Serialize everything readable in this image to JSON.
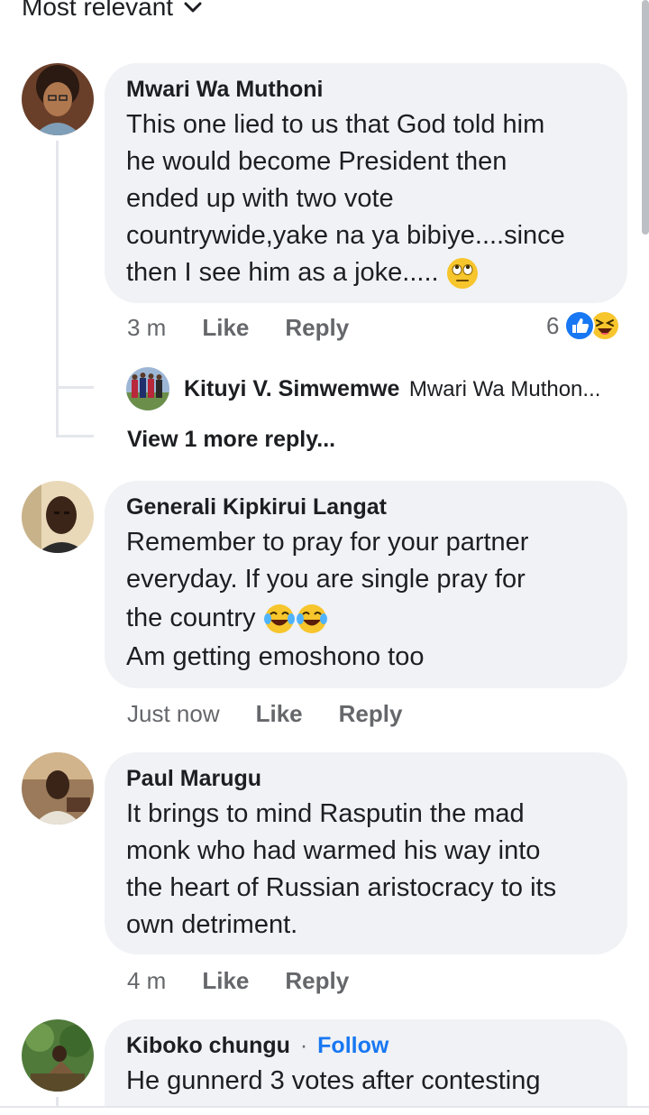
{
  "sort": {
    "label": "Most relevant"
  },
  "comments": [
    {
      "name": "Mwari Wa Muthoni",
      "lines": [
        "This one lied to us that God told him",
        "he would become President then",
        "ended up with two vote",
        "countrywide,yake na ya bibiye....since",
        "then I see him as a joke....."
      ],
      "time": "3 m",
      "like": "Like",
      "reply": "Reply",
      "reaction_count": "6",
      "reply_preview": {
        "name": "Kituyi V. Simwemwe",
        "text": "Mwari Wa Muthon..."
      },
      "view_more": "View 1 more reply..."
    },
    {
      "name": "Generali Kipkirui Langat",
      "lines": [
        "Remember to pray for your partner",
        "everyday. If you are single pray for",
        "the country",
        "Am getting emoshono too"
      ],
      "time": "Just now",
      "like": "Like",
      "reply": "Reply"
    },
    {
      "name": "Paul Marugu",
      "lines": [
        "It brings to mind Rasputin the mad",
        "monk who had warmed his way into",
        "the heart of Russian aristocracy to its",
        "own detriment."
      ],
      "time": "4 m",
      "like": "Like",
      "reply": "Reply"
    },
    {
      "name": "Kiboko chungu",
      "follow": "Follow",
      "lines": [
        "He gunnerd 3 votes after contesting"
      ]
    }
  ],
  "colors": {
    "like_blue": "#1877f2",
    "bubble_bg": "#f0f2f5",
    "meta_gray": "#65676b"
  }
}
